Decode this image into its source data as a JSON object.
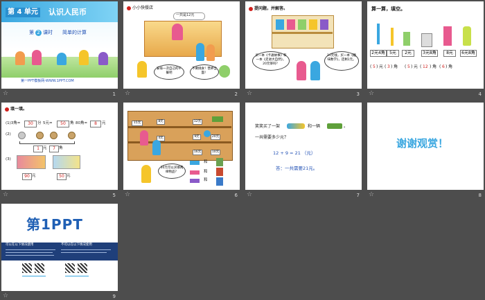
{
  "slides": [
    {
      "number": "1",
      "unit_badge": "第 4 单元",
      "unit_title": "认识人民币",
      "lesson_prefix": "第",
      "lesson_no": "2",
      "lesson_suffix": "课时",
      "lesson_name": "简单的计算",
      "footer": "第一PPT模板网-WWW.1PPT.COM"
    },
    {
      "number": "2",
      "shop": "小小快餐店",
      "price": "一共是12元",
      "bubble_left": "安排一次自己的午餐吧",
      "bubble_right": "不要挑食！营养全面！"
    },
    {
      "number": "3",
      "heading": "提问题，并解答。",
      "bubble1": "买一本《卡通故事》和一本《走进大自然》，20元够吗？",
      "bubble2": "10元钱，买一本《趣味数学》，还剩1元。"
    },
    {
      "number": "4",
      "heading": "算一算，填空。",
      "prices": [
        "2元4角",
        "5元",
        "2元",
        "3元8角",
        "8元",
        "6元8角"
      ],
      "answers": [
        "5",
        "3",
        "5",
        "12",
        "6"
      ],
      "unit_yuan": "元",
      "unit_jiao": "角"
    },
    {
      "number": "5",
      "heading": "填一填。",
      "line1_a": "(1)3角=",
      "line1_b": "30",
      "line1_c": "分",
      "line1_d": "5元=",
      "line1_e": "50",
      "line1_f": "角",
      "line1_g": "80角=",
      "line1_h": "8",
      "line1_i": "元",
      "line2": "(2)",
      "line2_a": "1",
      "line2_b": "元",
      "line2_c": "7",
      "line2_d": "角",
      "line3": "(3)",
      "line3_a": "90",
      "line3_b": "50",
      "yuan": "元"
    },
    {
      "number": "6",
      "prices": [
        "15元",
        "8元",
        "12元",
        "4元",
        "9元",
        "20元",
        "16元",
        "10元"
      ],
      "bubble": "30元可以买哪两样物品？",
      "and": "和"
    },
    {
      "number": "7",
      "q1": "笑笑买了一架",
      "q2": "和一辆",
      "q3": "。",
      "q4": "一共需要多少元？",
      "equation": "12 + 9 = 21 （元）",
      "answer": "答：一共需要21元。"
    },
    {
      "number": "8",
      "thanks": "谢谢观赏！"
    },
    {
      "number": "9",
      "logo": "第1PPT",
      "col1_title": "可以在以下情况使用",
      "col2_title": "不可以在以下情况使用"
    }
  ],
  "colors": {
    "background": "#4d4d4d",
    "selected": "#f0a020",
    "accent_red": "#d0201c",
    "accent_blue": "#1f4fb4"
  }
}
